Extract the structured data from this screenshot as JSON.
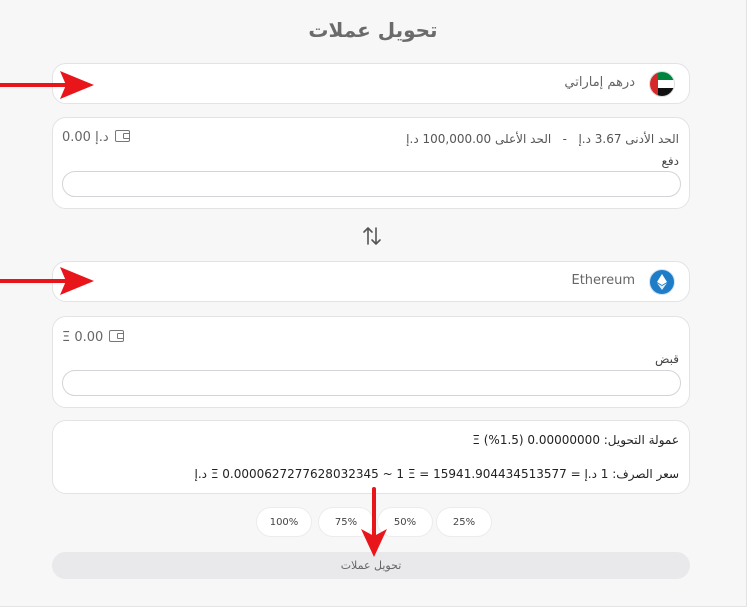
{
  "page": {
    "title": "تحويل عملات"
  },
  "from": {
    "currency_name": "درهم إماراتي",
    "limits_min": "الحد الأدنى 3.67 د.إ",
    "limits_sep": "-",
    "limits_max": "الحد الأعلى 100,000.00 د.إ",
    "balance": "0.00 د.إ",
    "field_label": "دفع",
    "input_value": ""
  },
  "to": {
    "currency_name": "Ethereum",
    "balance": "Ξ 0.00",
    "field_label": "قبض",
    "input_value": ""
  },
  "info": {
    "fee": "عمولة التحويل: 0.00000000 Ξ (%1.5)",
    "rate": "سعر الصرف: 1 د.إ = Ξ 0.0000627277628032345 ~ 1 Ξ = 15941.904434513577 د.إ"
  },
  "percent_buttons": [
    "25%",
    "50%",
    "75%",
    "100%"
  ],
  "submit": {
    "label": "تحويل عملات"
  },
  "colors": {
    "annotation_arrow": "#e8161b",
    "eth_icon": "#1f7cc7"
  },
  "icons": [
    "uae-flag-icon",
    "ethereum-icon",
    "wallet-icon",
    "swap-arrows-icon"
  ]
}
